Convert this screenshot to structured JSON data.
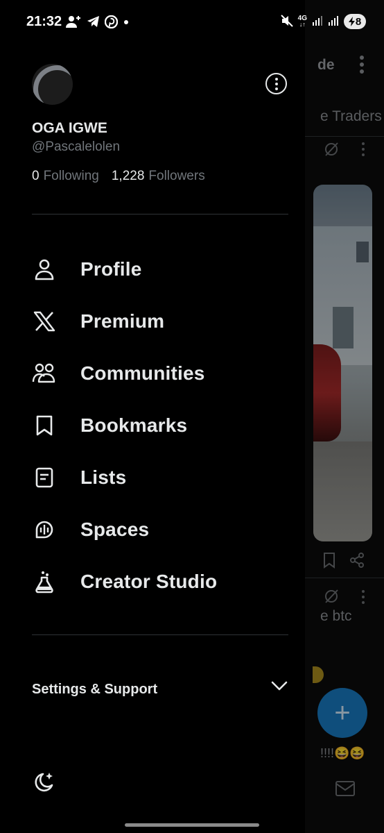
{
  "status_bar": {
    "time": "21:32",
    "network": "4G",
    "battery": "8",
    "left_icons": [
      "add-user-icon",
      "telegram-icon",
      "pinterest-icon",
      "dot-icon"
    ],
    "right_icons": [
      "mute-icon",
      "signal-icon",
      "battery-icon"
    ]
  },
  "feed": {
    "header_text": "de",
    "tab_text": "e Traders",
    "post_text": "e btc",
    "reaction_text": "!!!!😆😆",
    "fab_label": "+",
    "accent": "#1d9bf0"
  },
  "profile": {
    "name": "OGA IGWE",
    "handle": "@Pascalelolen",
    "following_count": "0",
    "following_label": "Following",
    "followers_count": "1,228",
    "followers_label": "Followers"
  },
  "menu": [
    {
      "label": "Profile",
      "icon": "profile-icon"
    },
    {
      "label": "Premium",
      "icon": "x-logo-icon"
    },
    {
      "label": "Communities",
      "icon": "communities-icon"
    },
    {
      "label": "Bookmarks",
      "icon": "bookmark-icon"
    },
    {
      "label": "Lists",
      "icon": "lists-icon"
    },
    {
      "label": "Spaces",
      "icon": "spaces-icon"
    },
    {
      "label": "Creator Studio",
      "icon": "creator-studio-icon"
    }
  ],
  "settings": {
    "label": "Settings & Support",
    "icon": "chevron-down-icon"
  },
  "footer": {
    "theme_icon": "moon-icon"
  },
  "colors": {
    "background": "#000000",
    "text": "#e7e9ea",
    "muted": "#71767b",
    "divider": "#2f3336"
  }
}
